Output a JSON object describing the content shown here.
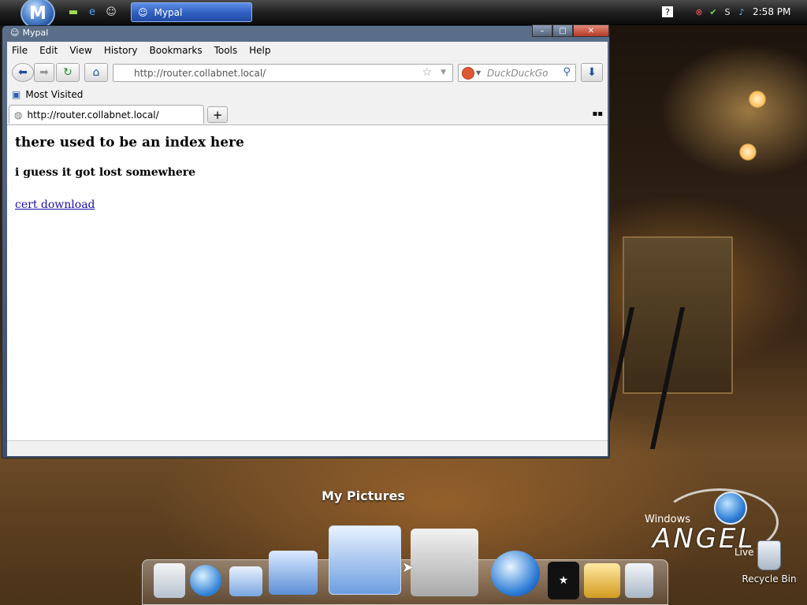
{
  "taskbar": {
    "task_button_label": "Mypal",
    "clock": "2:58 PM"
  },
  "window": {
    "title": "Mypal",
    "controls": {
      "minimize": "–",
      "maximize": "□",
      "close": "✕"
    }
  },
  "menu": {
    "file": "File",
    "edit": "Edit",
    "view": "View",
    "history": "History",
    "bookmarks": "Bookmarks",
    "tools": "Tools",
    "help": "Help"
  },
  "navigation": {
    "url": "http://router.collabnet.local/",
    "search_placeholder": "DuckDuckGo"
  },
  "bookmarks_toolbar": {
    "most_visited": "Most Visited"
  },
  "tab": {
    "title": "http://router.collabnet.local/"
  },
  "page": {
    "heading": "there used to be an index here",
    "subheading": "i guess it got lost somewhere",
    "link": "cert download"
  },
  "desktop": {
    "dock_label": "My Pictures",
    "brand_windows": "Windows",
    "brand_angel": "ANGEL",
    "brand_version": "Live V.2.0",
    "recycle_bin": "Recycle Bin"
  },
  "icons": {
    "start": "start-orb-icon",
    "back": "back-arrow-icon",
    "forward": "forward-arrow-icon",
    "reload": "reload-icon",
    "home": "home-icon",
    "download": "download-icon",
    "bookmark_star": "star-icon",
    "search": "magnifier-icon"
  },
  "colors": {
    "link": "#1a0dab",
    "task_button": "#2f5fc0",
    "duckduckgo": "#de5833"
  }
}
